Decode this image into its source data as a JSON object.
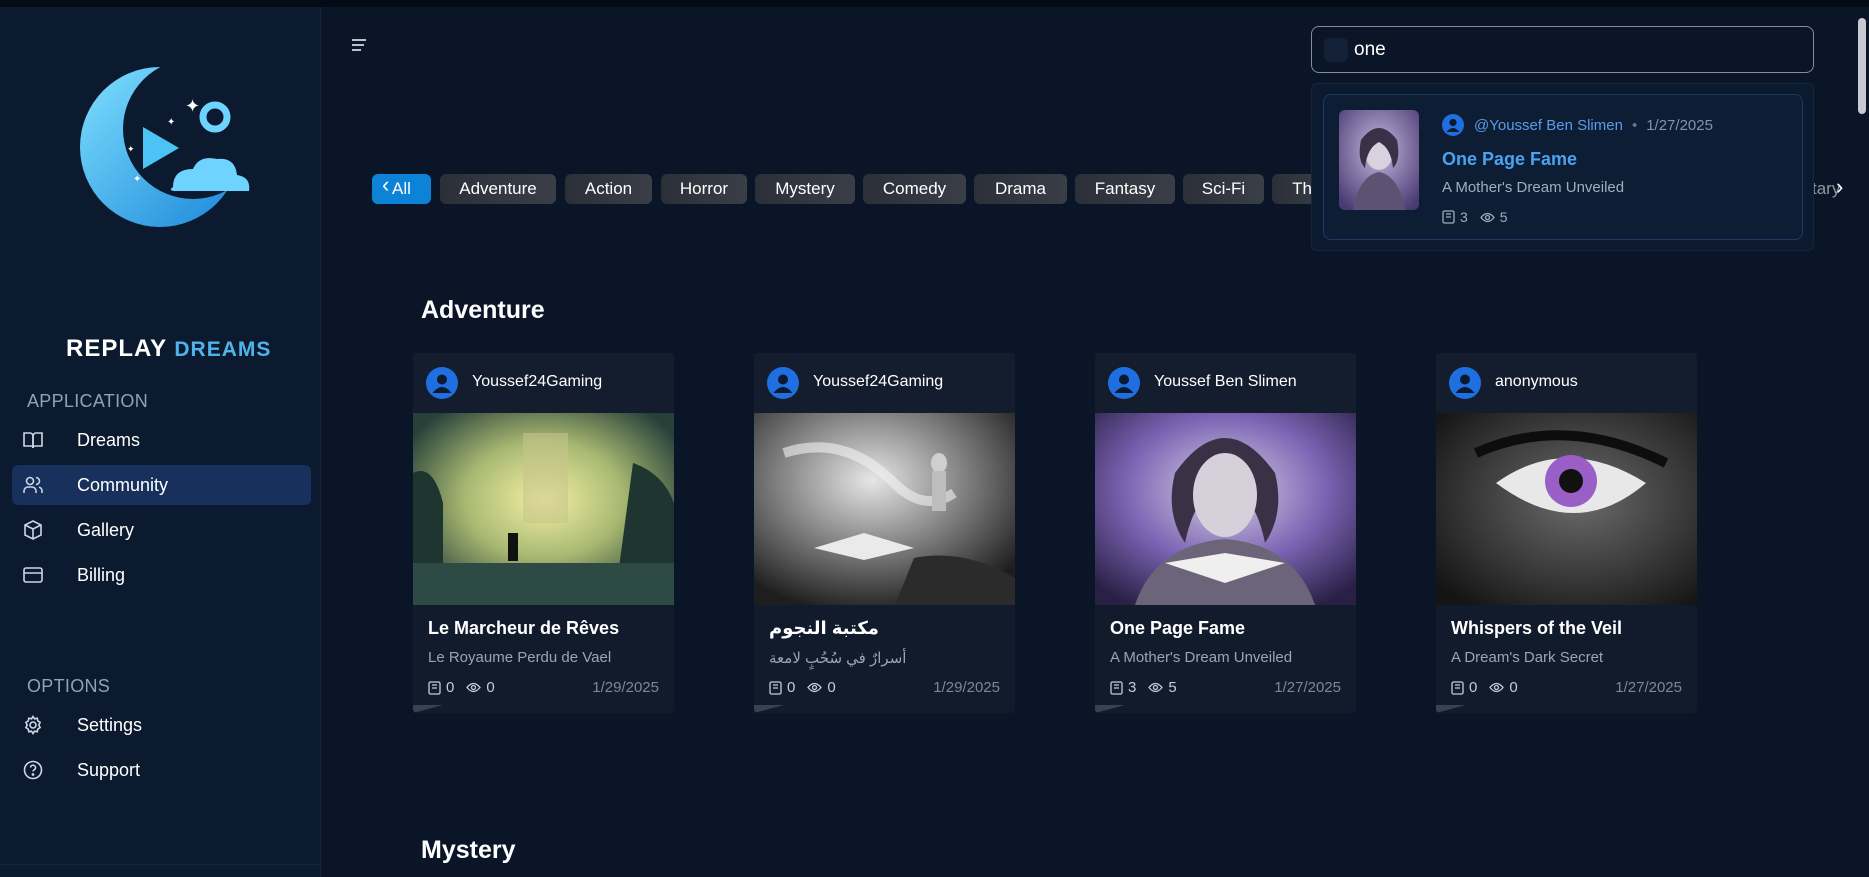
{
  "app": {
    "brand_word1": "REPLAY",
    "brand_word2": "DREAMS"
  },
  "colors": {
    "accent": "#0c83d6",
    "active_nav": "#17305c",
    "link": "#4aa3f0",
    "background": "#0a1628"
  },
  "sidebar": {
    "application_label": "APPLICATION",
    "items": [
      {
        "label": "Dreams",
        "icon": "book-open-icon"
      },
      {
        "label": "Community",
        "icon": "users-icon",
        "active": true
      },
      {
        "label": "Gallery",
        "icon": "cube-icon"
      },
      {
        "label": "Billing",
        "icon": "credit-card-icon"
      }
    ],
    "options_label": "OPTIONS",
    "options": [
      {
        "label": "Settings",
        "icon": "gear-icon"
      },
      {
        "label": "Support",
        "icon": "help-circle-icon"
      }
    ]
  },
  "search": {
    "value": "one"
  },
  "search_result": {
    "author": "@Youssef Ben Slimen",
    "date": "1/27/2025",
    "title": "One Page Fame",
    "subtitle": "A Mother's Dream Unveiled",
    "pages": "3",
    "views": "5"
  },
  "categories": {
    "items": [
      "All",
      "Adventure",
      "Action",
      "Horror",
      "Mystery",
      "Comedy",
      "Drama",
      "Fantasy",
      "Sci-Fi",
      "Th"
    ],
    "selected": "All",
    "trailing_partial": "tary"
  },
  "sections": [
    {
      "title": "Adventure",
      "cards": [
        {
          "author": "Youssef24Gaming",
          "title": "Le Marcheur de Rêves",
          "subtitle": "Le Royaume Perdu de Vael",
          "pages": "0",
          "views": "0",
          "date": "1/29/2025"
        },
        {
          "author": "Youssef24Gaming",
          "title": "مكتبة النجوم",
          "subtitle": "أسرارٌ في سُحُبٍ لامعة",
          "pages": "0",
          "views": "0",
          "date": "1/29/2025"
        },
        {
          "author": "Youssef Ben Slimen",
          "title": "One Page Fame",
          "subtitle": "A Mother's Dream Unveiled",
          "pages": "3",
          "views": "5",
          "date": "1/27/2025"
        },
        {
          "author": "anonymous",
          "title": "Whispers of the Veil",
          "subtitle": "A Dream's Dark Secret",
          "pages": "0",
          "views": "0",
          "date": "1/27/2025"
        }
      ]
    },
    {
      "title": "Mystery"
    }
  ]
}
